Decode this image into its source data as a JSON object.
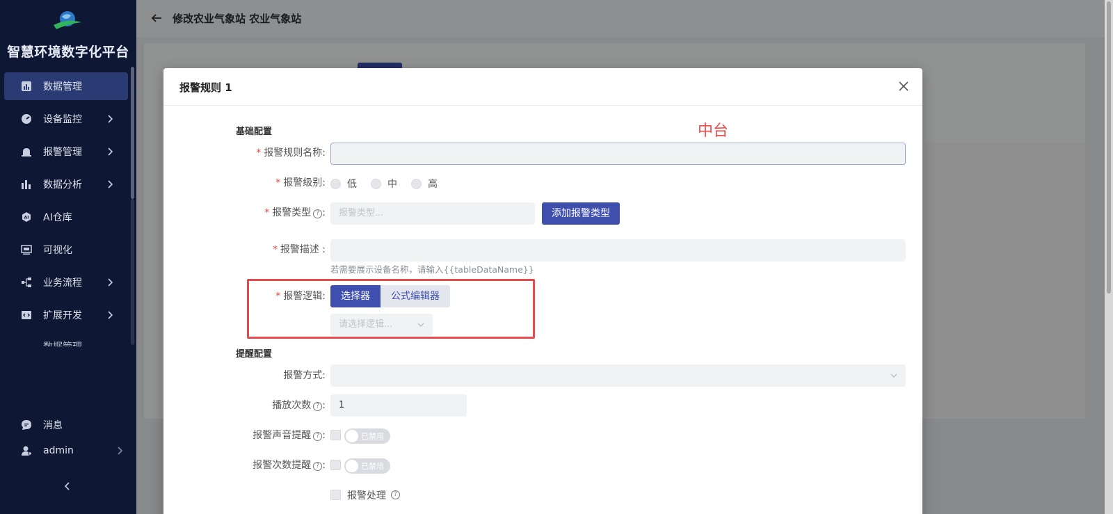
{
  "sidebar": {
    "brand": "智慧环境数字化平台",
    "items": [
      {
        "label": "数据管理",
        "icon": "bar-chart-icon",
        "active": true,
        "has_children": false
      },
      {
        "label": "设备监控",
        "icon": "gauge-icon",
        "active": false,
        "has_children": true
      },
      {
        "label": "报警管理",
        "icon": "alarm-icon",
        "active": false,
        "has_children": true
      },
      {
        "label": "数据分析",
        "icon": "analytics-icon",
        "active": false,
        "has_children": true
      },
      {
        "label": "AI仓库",
        "icon": "ai-icon",
        "active": false,
        "has_children": false
      },
      {
        "label": "可视化",
        "icon": "monitor-icon",
        "active": false,
        "has_children": false
      },
      {
        "label": "业务流程",
        "icon": "flow-icon",
        "active": false,
        "has_children": true
      },
      {
        "label": "扩展开发",
        "icon": "code-icon",
        "active": false,
        "has_children": true
      }
    ],
    "peek_label": "数据管理",
    "messages_label": "消息",
    "user_label": "admin"
  },
  "header": {
    "title": "修改农业气象站 农业气象站"
  },
  "dialog": {
    "title": "报警规则 1",
    "annotation": "中台",
    "basic_section": "基础配置",
    "rule_name": {
      "label": "报警规则名称:",
      "value": ""
    },
    "level": {
      "label": "报警级别:",
      "options": [
        "低",
        "中",
        "高"
      ]
    },
    "type": {
      "label": "报警类型",
      "placeholder": "报警类型...",
      "add_button": "添加报警类型"
    },
    "description": {
      "label": "报警描述 :",
      "value": "",
      "hint": "若需要展示设备名称，请输入{{tableDataName}}"
    },
    "logic": {
      "label": "报警逻辑:",
      "tab_selector": "选择器",
      "tab_formula": "公式编辑器",
      "placeholder": "请选择逻辑..."
    },
    "reminder_section": "提醒配置",
    "method": {
      "label": "报警方式:",
      "value": ""
    },
    "play_count": {
      "label": "播放次数",
      "value": "1"
    },
    "sound_reminder": {
      "label": "报警声音提醒",
      "switch_text": "已禁用"
    },
    "count_reminder": {
      "label": "报警次数提醒",
      "switch_text": "已禁用"
    },
    "handling": {
      "label": "报警处理"
    }
  },
  "colors": {
    "primary": "#3e4fae",
    "sidebar_bg": "#0e1733",
    "annotation": "#ee4b4b"
  }
}
